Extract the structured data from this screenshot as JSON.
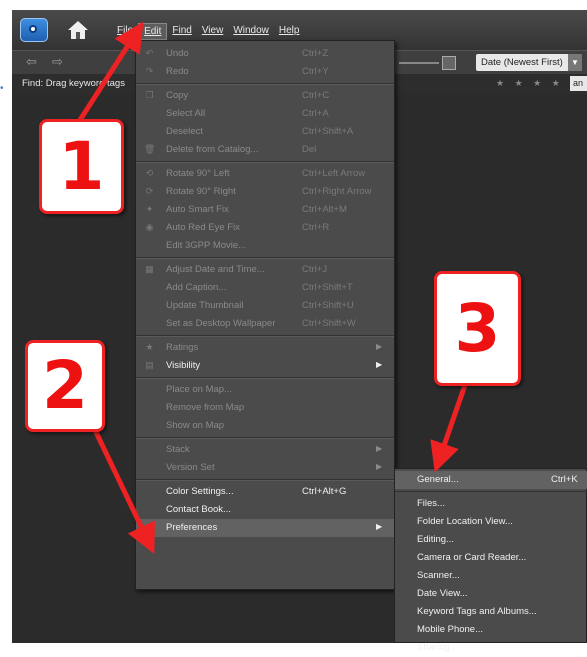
{
  "window": {
    "menus": [
      "File",
      "Edit",
      "Find",
      "View",
      "Window",
      "Help"
    ],
    "active_menu": "Edit",
    "sort_select": "Date (Newest First)",
    "find_label": "Find: Drag keyword tags",
    "and_select": "an",
    "stars": "★ ★ ★ ★ ★"
  },
  "icons": [
    "camera-logo-icon",
    "home-icon",
    "back-arrow-icon",
    "forward-arrow-icon"
  ],
  "edit_menu": [
    {
      "type": "item",
      "label": "Undo",
      "shortcut": "Ctrl+Z",
      "enabled": false,
      "icon": "undo-icon"
    },
    {
      "type": "item",
      "label": "Redo",
      "shortcut": "Ctrl+Y",
      "enabled": false,
      "icon": "redo-icon"
    },
    {
      "type": "sep"
    },
    {
      "type": "item",
      "label": "Copy",
      "shortcut": "Ctrl+C",
      "enabled": false,
      "icon": "copy-icon"
    },
    {
      "type": "item",
      "label": "Select All",
      "shortcut": "Ctrl+A",
      "enabled": false,
      "icon": ""
    },
    {
      "type": "item",
      "label": "Deselect",
      "shortcut": "Ctrl+Shift+A",
      "enabled": false,
      "icon": ""
    },
    {
      "type": "item",
      "label": "Delete from Catalog...",
      "shortcut": "Del",
      "enabled": false,
      "icon": "trash-icon"
    },
    {
      "type": "sep"
    },
    {
      "type": "item",
      "label": "Rotate 90° Left",
      "shortcut": "Ctrl+Left Arrow",
      "enabled": false,
      "icon": "rotate-left-icon"
    },
    {
      "type": "item",
      "label": "Rotate 90° Right",
      "shortcut": "Ctrl+Right Arrow",
      "enabled": false,
      "icon": "rotate-right-icon"
    },
    {
      "type": "item",
      "label": "Auto Smart Fix",
      "shortcut": "Ctrl+Alt+M",
      "enabled": false,
      "icon": "smart-fix-icon"
    },
    {
      "type": "item",
      "label": "Auto Red Eye Fix",
      "shortcut": "Ctrl+R",
      "enabled": false,
      "icon": "red-eye-icon"
    },
    {
      "type": "item",
      "label": "Edit 3GPP Movie...",
      "shortcut": "",
      "enabled": false,
      "icon": ""
    },
    {
      "type": "sep"
    },
    {
      "type": "item",
      "label": "Adjust Date and Time...",
      "shortcut": "Ctrl+J",
      "enabled": false,
      "icon": "calendar-icon"
    },
    {
      "type": "item",
      "label": "Add Caption...",
      "shortcut": "Ctrl+Shift+T",
      "enabled": false,
      "icon": ""
    },
    {
      "type": "item",
      "label": "Update Thumbnail",
      "shortcut": "Ctrl+Shift+U",
      "enabled": false,
      "icon": ""
    },
    {
      "type": "item",
      "label": "Set as Desktop Wallpaper",
      "shortcut": "Ctrl+Shift+W",
      "enabled": false,
      "icon": ""
    },
    {
      "type": "sep"
    },
    {
      "type": "item",
      "label": "Ratings",
      "shortcut": "",
      "enabled": false,
      "icon": "star-icon",
      "submenu": true
    },
    {
      "type": "item",
      "label": "Visibility",
      "shortcut": "",
      "enabled": true,
      "icon": "visibility-icon",
      "submenu": true
    },
    {
      "type": "sep"
    },
    {
      "type": "item",
      "label": "Place on Map...",
      "shortcut": "",
      "enabled": false,
      "icon": ""
    },
    {
      "type": "item",
      "label": "Remove from Map",
      "shortcut": "",
      "enabled": false,
      "icon": ""
    },
    {
      "type": "item",
      "label": "Show on Map",
      "shortcut": "",
      "enabled": false,
      "icon": ""
    },
    {
      "type": "sep"
    },
    {
      "type": "item",
      "label": "Stack",
      "shortcut": "",
      "enabled": false,
      "icon": "",
      "submenu": true
    },
    {
      "type": "item",
      "label": "Version Set",
      "shortcut": "",
      "enabled": false,
      "icon": "",
      "submenu": true
    },
    {
      "type": "sep"
    },
    {
      "type": "item",
      "label": "Color Settings...",
      "shortcut": "Ctrl+Alt+G",
      "enabled": true,
      "icon": ""
    },
    {
      "type": "item",
      "label": "Contact Book...",
      "shortcut": "",
      "enabled": true,
      "icon": ""
    },
    {
      "type": "item",
      "label": "Preferences",
      "shortcut": "",
      "enabled": true,
      "icon": "",
      "submenu": true,
      "highlight": true
    }
  ],
  "preferences_menu": [
    {
      "label": "General...",
      "shortcut": "Ctrl+K",
      "highlight": true
    },
    {
      "label": "Files..."
    },
    {
      "label": "Folder Location View..."
    },
    {
      "label": "Editing..."
    },
    {
      "label": "Camera or Card Reader..."
    },
    {
      "label": "Scanner..."
    },
    {
      "label": "Date View..."
    },
    {
      "label": "Keyword Tags and Albums..."
    },
    {
      "label": "Mobile Phone..."
    },
    {
      "label": "Sharing..."
    }
  ],
  "callouts": [
    "1",
    "2",
    "3"
  ],
  "colors": {
    "callout_red": "#e62222",
    "menu_bg": "#4b4b4b",
    "app_bg": "#2b2b2b"
  }
}
